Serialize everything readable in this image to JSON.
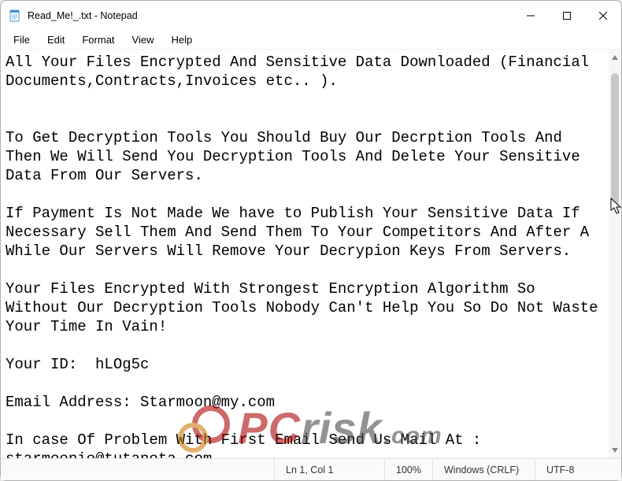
{
  "window": {
    "title": "Read_Me!_.txt - Notepad"
  },
  "menubar": {
    "file": "File",
    "edit": "Edit",
    "format": "Format",
    "view": "View",
    "help": "Help"
  },
  "document": {
    "text": "All Your Files Encrypted And Sensitive Data Downloaded (Financial Documents,Contracts,Invoices etc.. ).\n\n\nTo Get Decryption Tools You Should Buy Our Decrption Tools And Then We Will Send You Decryption Tools And Delete Your Sensitive Data From Our Servers.\n\nIf Payment Is Not Made We have to Publish Your Sensitive Data If Necessary Sell Them And Send Them To Your Competitors And After A While Our Servers Will Remove Your Decrypion Keys From Servers.\n\nYour Files Encrypted With Strongest Encryption Algorithm So Without Our Decryption Tools Nobody Can't Help You So Do Not Waste Your Time In Vain!\n\nYour ID:  hLOg5c\n\nEmail Address: Starmoon@my.com\n\nIn case Of Problem With First Email Send Us Mail At : starmoonio@tutanota.com"
  },
  "statusbar": {
    "position": "Ln 1, Col 1",
    "zoom": "100%",
    "line_ending": "Windows (CRLF)",
    "encoding": "UTF-8"
  },
  "watermark": {
    "pc": "PC",
    "risk": "risk",
    "com": ".com"
  }
}
